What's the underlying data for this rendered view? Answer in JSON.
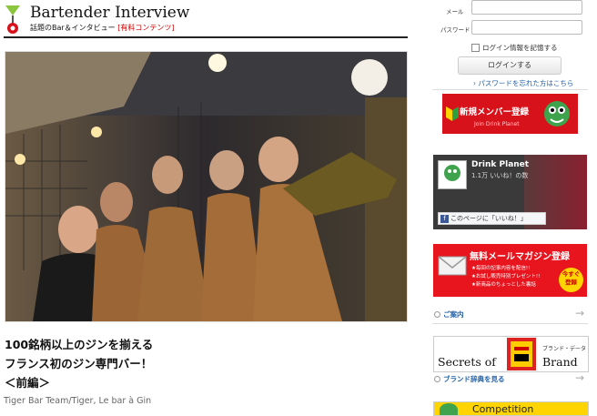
{
  "header": {
    "title": "Bartender Interview",
    "subtitle": "話題のBar＆インタビュー",
    "premium_tag": "[有料コンテンツ]"
  },
  "article": {
    "title_lines": [
      "100銘柄以上のジンを揃える",
      "フランス初のジン専門バー！",
      "＜前編＞"
    ],
    "subtitle": "Tiger Bar Team/Tiger, Le bar à Gin"
  },
  "login": {
    "email_label": "メール",
    "password_label": "パスワード",
    "remember_label": "ログイン情報を記憶する",
    "login_button": "ログインする",
    "forgot_link": "パスワードを忘れた方はこちら"
  },
  "register_banner": {
    "title": "新規メンバー登録",
    "subtitle": "Join Drink Planet"
  },
  "facebook": {
    "page_name": "Drink Planet",
    "likes": "1.1万 いいね！の数",
    "like_button": "このページに「いいね！」"
  },
  "mail_magazine": {
    "title": "無料メールマガジン登録",
    "bullets": [
      "★毎回の記事内容を配信!!",
      "★お試し販売特別プレゼント!!",
      "★新商品のちょっとした裏話"
    ],
    "badge": [
      "今すぐ",
      "登録"
    ],
    "link": "ご案内"
  },
  "brand_dict": {
    "banner_left": "Secrets of",
    "banner_right": "Brand",
    "banner_tag": "ブランド・データ",
    "link": "ブランド辞典を見る"
  },
  "competition": {
    "label": "Competition"
  },
  "colors": {
    "accent_red": "#d8121a",
    "link_blue": "#1f5fa8",
    "badge_yellow": "#ffd400"
  }
}
